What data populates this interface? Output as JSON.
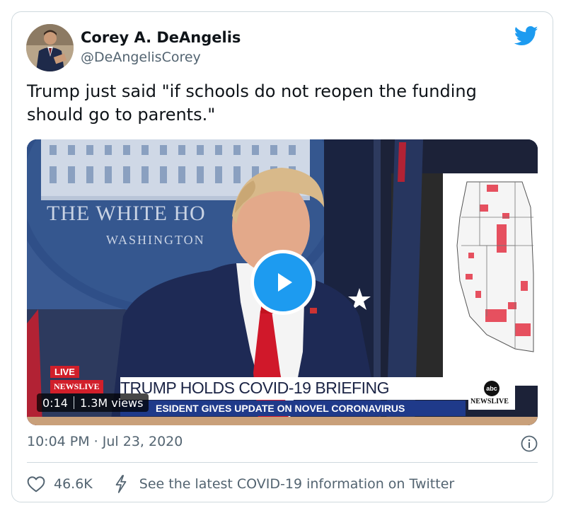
{
  "author": {
    "display_name": "Corey A. DeAngelis",
    "handle": "@DeAngelisCorey"
  },
  "tweet": {
    "text": "Trump just said \"if schools do not reopen the funding should go to parents.\"",
    "timestamp": "10:04 PM · Jul 23, 2020"
  },
  "video": {
    "duration": "0:14",
    "views": "1.3M views",
    "scene": {
      "building_text": "THE WHITE HO",
      "building_subtext": "WASHINGTON",
      "live_label": "LIVE",
      "network_small": "NEWSLIVE",
      "banner_title": "TRUMP HOLDS COVID-19 BRIEFING",
      "banner_subtitle": "ESIDENT GIVES UPDATE ON NOVEL CORONAVIRUS",
      "logo_text": "abc",
      "logo_newslive": "NEWSLIVE"
    }
  },
  "actions": {
    "likes": "46.6K",
    "covid_link": "See the latest COVID-19 information on Twitter"
  },
  "icons": {
    "brand": "twitter-bird-icon",
    "play": "play-icon",
    "info": "info-icon",
    "like": "heart-icon",
    "covid": "lightning-icon"
  },
  "colors": {
    "accent": "#1d9bf0",
    "text_primary": "#0f1419",
    "text_secondary": "#536471",
    "border": "#cfd9de"
  }
}
